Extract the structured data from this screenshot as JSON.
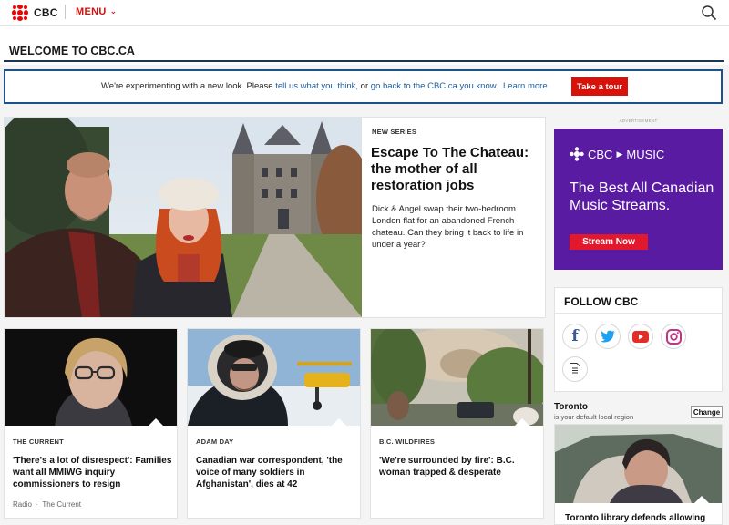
{
  "header": {
    "logo_text": "CBC",
    "menu_label": "MENU",
    "menu_icon": "chevron-down-icon",
    "search_icon": "search-icon",
    "brand_color": "#d6120a"
  },
  "welcome": {
    "title": "WELCOME TO CBC.CA"
  },
  "notice": {
    "text_1": "We're experimenting with a new look. Please ",
    "link_feedback": "tell us what you think",
    "text_2": ", or ",
    "link_classic": "go back to the CBC.ca you know.",
    "link_learn": "Learn more",
    "tour_button": "Take a tour"
  },
  "hero": {
    "tag": "NEW SERIES",
    "title": "Escape To The Chateau: the mother of all restoration jobs",
    "description": "Dick & Angel swap their two-bedroom London flat for an abandoned French chateau. Can they bring it back to life in under a year?"
  },
  "cards": [
    {
      "tag": "THE CURRENT",
      "title": "'There's a lot of disrespect': Families want all MMIWG inquiry commissioners to resign",
      "meta_type": "Radio",
      "meta_source": "The Current"
    },
    {
      "tag": "ADAM DAY",
      "title": "Canadian war correspondent, 'the voice of many soldiers in Afghanistan', dies at 42"
    },
    {
      "tag": "B.C. WILDFIRES",
      "title": "'We're surrounded by fire': B.C. woman trapped & desperate"
    }
  ],
  "ad": {
    "label": "ADVERTISEMENT",
    "brand": "CBC",
    "brand_suffix": "MUSIC",
    "headline": "The Best All Canadian Music Streams.",
    "button": "Stream Now",
    "background_color": "#5a1ba3"
  },
  "follow": {
    "title": "FOLLOW CBC",
    "icons": [
      "facebook-icon",
      "twitter-icon",
      "youtube-icon",
      "instagram-icon",
      "newsletter-icon"
    ]
  },
  "region": {
    "city": "Toronto",
    "subtitle": "is your default local region",
    "change_button": "Change",
    "story_title": "Toronto library defends allowing"
  }
}
